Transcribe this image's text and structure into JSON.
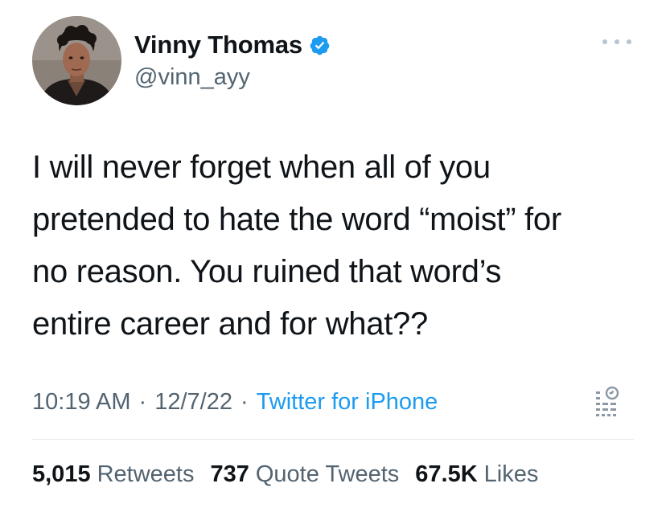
{
  "user": {
    "display_name": "Vinny Thomas",
    "handle": "@vinn_ayy",
    "verified": true,
    "avatar_icon": "profile-photo"
  },
  "tweet": {
    "lines": [
      "I will never forget when all of you",
      "pretended to hate the word “moist” for",
      "no reason. You ruined that word’s",
      "entire career and for what??"
    ]
  },
  "meta": {
    "time": "10:19 AM",
    "separator": "·",
    "date": "12/7/22",
    "source": "Twitter for iPhone",
    "icon": "view-tweet-analytics-icon"
  },
  "stats": {
    "retweets_count": "5,015",
    "retweets_label": "Retweets",
    "quotes_count": "737",
    "quotes_label": "Quote Tweets",
    "likes_count": "67.5K",
    "likes_label": "Likes"
  },
  "colors": {
    "text_primary": "#0f1419",
    "text_secondary": "#536471",
    "accent": "#1d9bf0",
    "divider": "#e1e8ed"
  }
}
